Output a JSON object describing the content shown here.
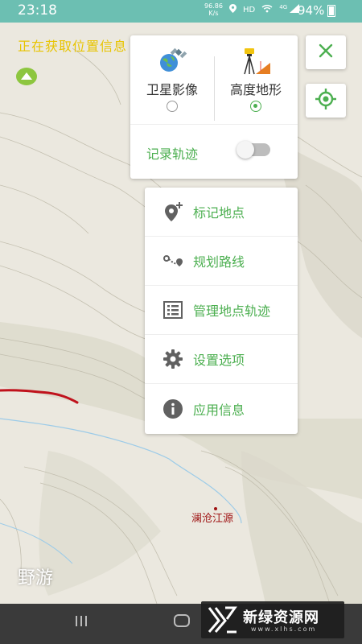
{
  "status_bar": {
    "time": "23:18",
    "speed_value": "96.86",
    "speed_unit": "K/s",
    "hd": "HD",
    "signal": "4G",
    "battery": "94%"
  },
  "map": {
    "locating_text": "正在获取位置信息",
    "place_label": "澜沧江源",
    "brand": "野游",
    "track_color": "#c0121c"
  },
  "layer_panel": {
    "satellite_label": "卫星影像",
    "terrain_label": "高度地形",
    "selected_layer": "terrain",
    "track_record_label": "记录轨迹",
    "track_record_on": false
  },
  "menu": {
    "items": [
      {
        "label": "标记地点",
        "icon": "add-location-icon"
      },
      {
        "label": "规划路线",
        "icon": "route-icon"
      },
      {
        "label": "管理地点轨迹",
        "icon": "list-icon"
      },
      {
        "label": "设置选项",
        "icon": "gear-icon"
      },
      {
        "label": "应用信息",
        "icon": "info-icon"
      }
    ]
  },
  "watermark": {
    "title": "新绿资源网",
    "url": "www.xlhs.com"
  },
  "colors": {
    "accent": "#4caf50",
    "status_bar": "#6cbfb2",
    "locating_text": "#e8c400"
  }
}
